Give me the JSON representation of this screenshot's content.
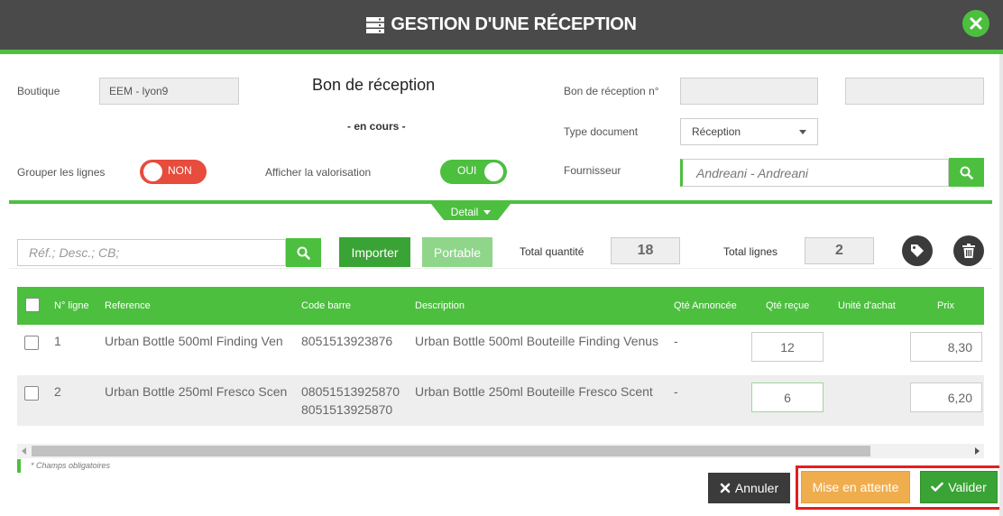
{
  "header": {
    "title": "GESTION D'UNE RÉCEPTION",
    "icon": "server-icon",
    "close_icon": "close-icon"
  },
  "form": {
    "boutique_label": "Boutique",
    "boutique_value": "EEM - lyon9",
    "bon_title": "Bon de réception",
    "status": "- en cours -",
    "bon_numero_label": "Bon de réception n°",
    "bon_numero_value": "",
    "bon_numero_extra": "",
    "type_label": "Type document",
    "type_value": "Réception",
    "grouper_label": "Grouper les lignes",
    "grouper_value": "NON",
    "valorisation_label": "Afficher la valorisation",
    "valorisation_value": "OUI",
    "fournisseur_label": "Fournisseur",
    "fournisseur_value": "Andreani - Andreani"
  },
  "detail": {
    "tab_label": "Detail"
  },
  "toolbar": {
    "search_placeholder": "Réf.; Desc.; CB;",
    "importer_label": "Importer",
    "portable_label": "Portable",
    "total_quantite_label": "Total quantité",
    "total_quantite_value": "18",
    "total_lignes_label": "Total lignes",
    "total_lignes_value": "2"
  },
  "table": {
    "headers": [
      "N° ligne",
      "Reference",
      "Code barre",
      "Description",
      "Qté Annoncée",
      "Qté reçue",
      "Unité d'achat",
      "Prix"
    ],
    "rows": [
      {
        "ligne": "1",
        "reference": "Urban Bottle 500ml Finding Ven",
        "code_barre_1": "8051513923876",
        "code_barre_2": "",
        "description": "Urban Bottle 500ml Bouteille Finding Venus",
        "qte_annoncee": "-",
        "qte_recue": "12",
        "prix": "8,30"
      },
      {
        "ligne": "2",
        "reference": "Urban Bottle 250ml Fresco Scen",
        "code_barre_1": "08051513925870",
        "code_barre_2": "8051513925870",
        "description": "Urban Bottle 250ml Bouteille Fresco Scent",
        "qte_annoncee": "-",
        "qte_recue": "6",
        "prix": "6,20"
      }
    ]
  },
  "footer": {
    "required_note": "* Champs obligatoires",
    "annuler_label": "Annuler",
    "attente_label": "Mise en attente",
    "valider_label": "Valider"
  },
  "colors": {
    "accent": "#4cbf3f",
    "header": "#4a4a4a",
    "danger": "#e74c3c",
    "warning": "#f0ad4e",
    "highlight": "#e41e1e"
  }
}
